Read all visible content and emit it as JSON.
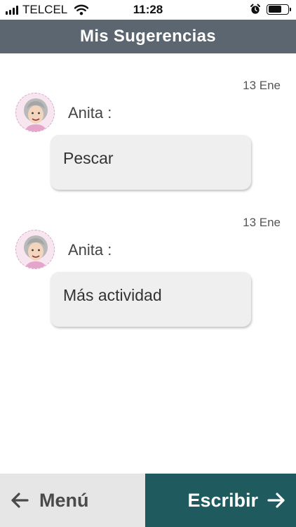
{
  "status_bar": {
    "carrier": "TELCEL",
    "time": "11:28",
    "battery_level": 0.7,
    "icons": [
      "signal-icon",
      "wifi-icon",
      "alarm-icon",
      "battery-icon"
    ]
  },
  "header": {
    "title": "Mis Sugerencias"
  },
  "messages": [
    {
      "date": "13 Ene",
      "sender": "Anita :",
      "text": "Pescar"
    },
    {
      "date": "13 Ene",
      "sender": "Anita :",
      "text": "Más actividad"
    }
  ],
  "bottom_bar": {
    "menu_label": "Menú",
    "write_label": "Escribir"
  },
  "colors": {
    "header_bg": "#5c6670",
    "write_button_bg": "#1e5a5e",
    "menu_button_bg": "#e6e6e6",
    "bubble_bg": "#efefef"
  }
}
